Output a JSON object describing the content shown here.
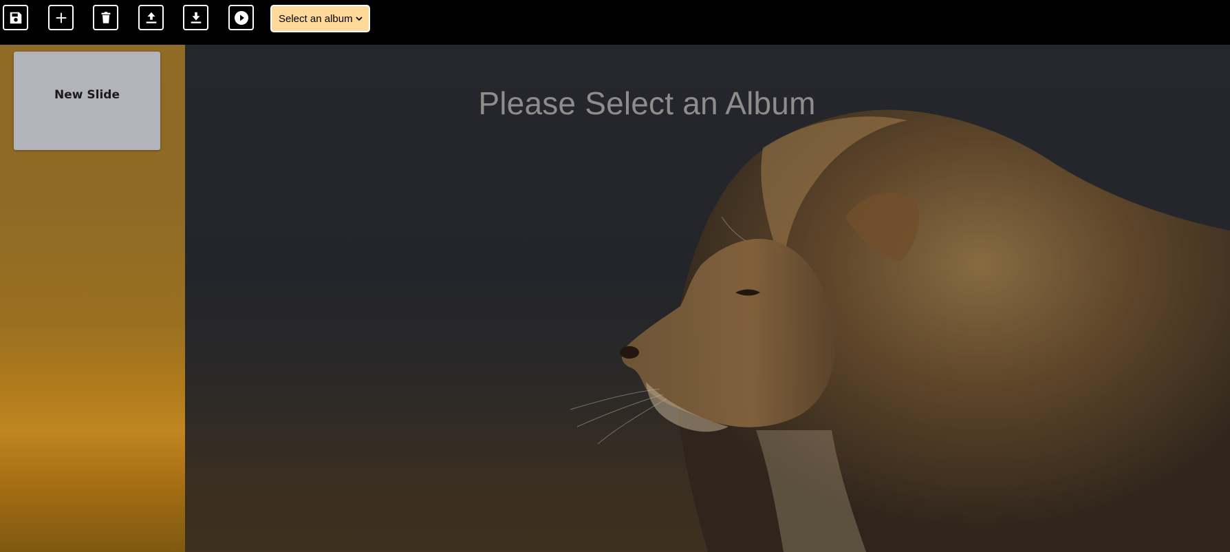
{
  "toolbar": {
    "buttons": [
      {
        "name": "save",
        "icon": "floppy-disk-icon"
      },
      {
        "name": "add",
        "icon": "plus-icon"
      },
      {
        "name": "delete",
        "icon": "trash-icon"
      },
      {
        "name": "upload",
        "icon": "upload-icon"
      },
      {
        "name": "download",
        "icon": "download-icon"
      },
      {
        "name": "play",
        "icon": "play-circle-icon"
      }
    ],
    "album_select": {
      "selected": "Select an album",
      "background_color": "#ffd99a"
    }
  },
  "sidebar": {
    "slides": [
      {
        "label": "New Slide"
      }
    ]
  },
  "stage": {
    "title": "Please Select an Album",
    "background_image": "lion-profile-photo"
  }
}
